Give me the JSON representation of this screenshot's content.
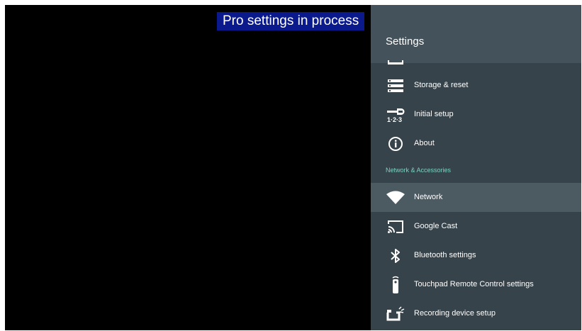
{
  "overlay": {
    "banner_text": "Pro settings in process"
  },
  "panel": {
    "title": "Settings",
    "items_top": [
      {
        "label": "Storage & reset",
        "icon": "storage-icon"
      },
      {
        "label": "Initial setup",
        "icon": "initial-setup-icon"
      },
      {
        "label": "About",
        "icon": "info-icon"
      }
    ],
    "section_header": "Network & Accessories",
    "items_network": [
      {
        "label": "Network",
        "icon": "wifi-icon",
        "selected": true
      },
      {
        "label": "Google Cast",
        "icon": "cast-icon"
      },
      {
        "label": "Bluetooth settings",
        "icon": "bluetooth-icon"
      },
      {
        "label": "Touchpad Remote Control settings",
        "icon": "remote-icon"
      },
      {
        "label": "Recording device setup",
        "icon": "recording-device-icon"
      }
    ]
  },
  "colors": {
    "screen_background": "#000000",
    "panel_background": "#37434a",
    "panel_header_background": "#44525b",
    "selected_row": "#4c5a62",
    "banner_background": "#0a1a8c",
    "section_header_text": "#7fd0c2"
  }
}
